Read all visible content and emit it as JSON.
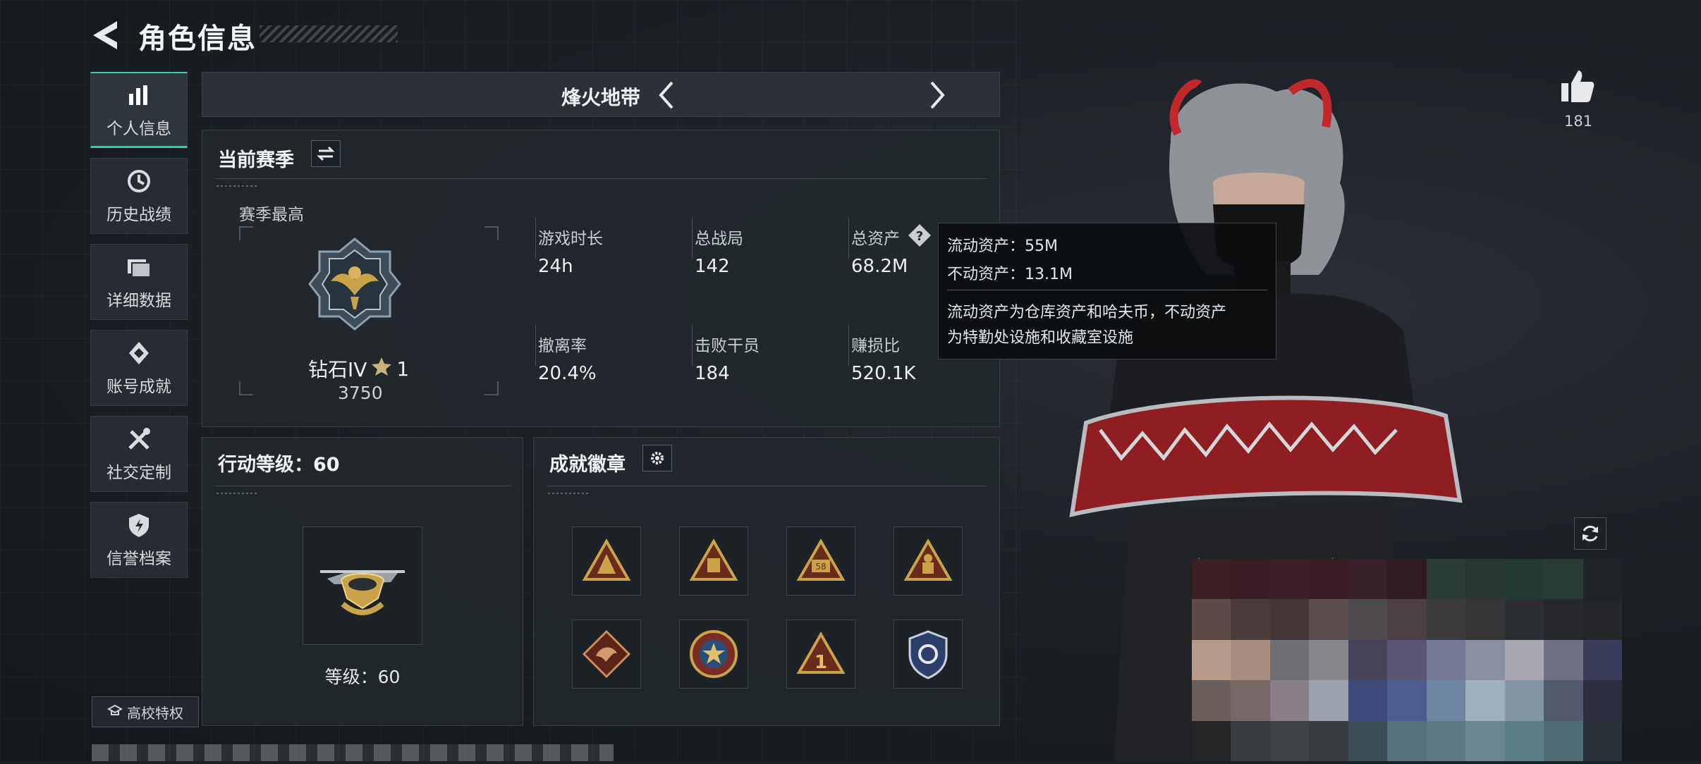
{
  "header": {
    "title": "角色信息"
  },
  "sidebar": {
    "items": [
      {
        "label": "个人信息",
        "icon": "bar-chart-icon"
      },
      {
        "label": "历史战绩",
        "icon": "history-icon"
      },
      {
        "label": "详细数据",
        "icon": "folder-icon"
      },
      {
        "label": "账号成就",
        "icon": "achievement-icon"
      },
      {
        "label": "社交定制",
        "icon": "tools-icon"
      },
      {
        "label": "信誉档案",
        "icon": "shield-icon"
      }
    ],
    "school_label": "高校特权"
  },
  "mode": {
    "label": "烽火地带"
  },
  "season": {
    "title": "当前赛季",
    "best_label": "赛季最高",
    "rank_name": "钻石IV",
    "rank_stars": "1",
    "rank_score": "3750",
    "stats": [
      {
        "label": "游戏时长",
        "value": "24h"
      },
      {
        "label": "总战局",
        "value": "142"
      },
      {
        "label": "总资产",
        "value": "68.2M"
      },
      {
        "label": "撤离率",
        "value": "20.4%"
      },
      {
        "label": "击败干员",
        "value": "184"
      },
      {
        "label": "赚损比",
        "value": "520.1K"
      }
    ]
  },
  "tooltip": {
    "liquid": "流动资产：55M",
    "fixed": "不动资产：13.1M",
    "desc_line1": "流动资产为仓库资产和哈夫币，不动资产",
    "desc_line2": "为特勤处设施和收藏室设施"
  },
  "action_level": {
    "title": "行动等级：60",
    "level_text": "等级：60"
  },
  "badges": {
    "title": "成就徽章",
    "items": [
      "triangle-badge",
      "triangle-crate-badge",
      "triangle-58-badge",
      "triangle-soldier-badge",
      "dragon-diamond-badge",
      "star-medal-badge",
      "triangle-1-badge",
      "shield-badge"
    ]
  },
  "likes": {
    "count": "181"
  },
  "colors": {
    "accent": "#2fd2a8",
    "gold": "#c9a24a",
    "bg": "#1a1f24",
    "red": "#c0282c"
  }
}
